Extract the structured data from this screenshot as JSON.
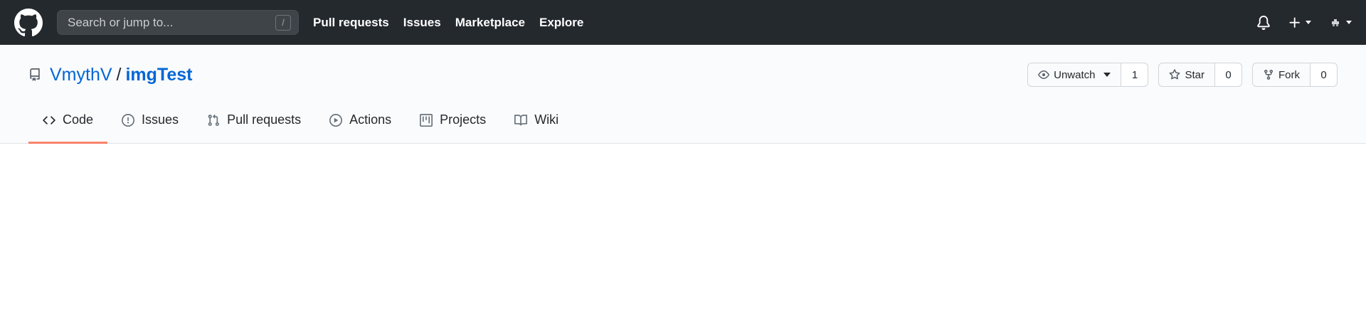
{
  "header": {
    "search_placeholder": "Search or jump to...",
    "search_shortcut": "/",
    "nav": [
      "Pull requests",
      "Issues",
      "Marketplace",
      "Explore"
    ]
  },
  "repo": {
    "owner": "VmythV",
    "separator": "/",
    "name": "imgTest",
    "watch": {
      "label": "Unwatch",
      "count": "1"
    },
    "star": {
      "label": "Star",
      "count": "0"
    },
    "fork": {
      "label": "Fork",
      "count": "0"
    }
  },
  "tabs": [
    {
      "label": "Code",
      "icon": "code-icon",
      "selected": true
    },
    {
      "label": "Issues",
      "icon": "issue-opened-icon",
      "selected": false
    },
    {
      "label": "Pull requests",
      "icon": "git-pull-request-icon",
      "selected": false
    },
    {
      "label": "Actions",
      "icon": "play-icon",
      "selected": false
    },
    {
      "label": "Projects",
      "icon": "project-icon",
      "selected": false
    },
    {
      "label": "Wiki",
      "icon": "book-icon",
      "selected": false
    }
  ],
  "colors": {
    "header_bg": "#24292e",
    "link_blue": "#0366d6",
    "selected_tab_underline": "#f9826c",
    "repohead_bg": "#fafbfc"
  }
}
